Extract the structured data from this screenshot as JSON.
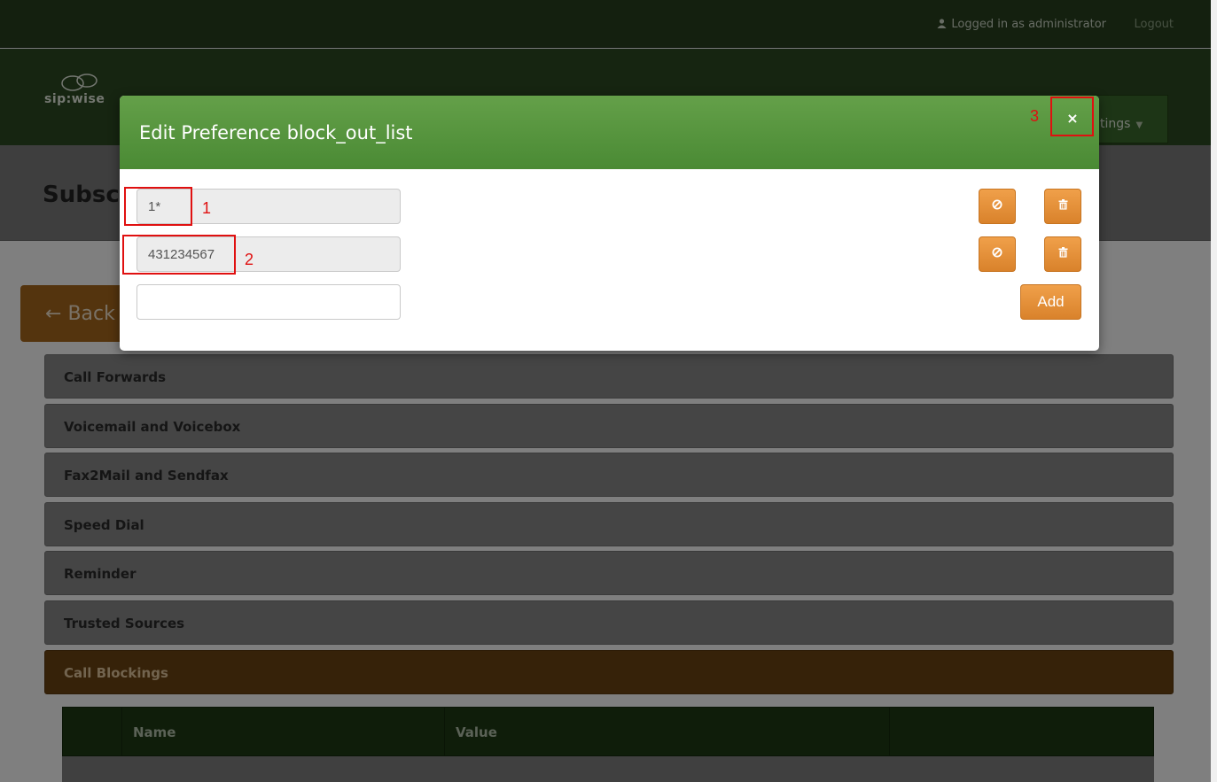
{
  "topbar": {
    "login_text": "Logged in as administrator",
    "logout_label": "Logout"
  },
  "nav": {
    "logo_text": "sip:wise",
    "settings_label": "tings"
  },
  "page": {
    "title": "Subsc",
    "back_label": "Back"
  },
  "accordion": [
    {
      "label": "Call Forwards"
    },
    {
      "label": "Voicemail and Voicebox"
    },
    {
      "label": "Fax2Mail and Sendfax"
    },
    {
      "label": "Speed Dial"
    },
    {
      "label": "Reminder"
    },
    {
      "label": "Trusted Sources"
    },
    {
      "label": "Call Blockings",
      "active": true
    }
  ],
  "table": {
    "columns": [
      "",
      "Name",
      "Value",
      ""
    ]
  },
  "modal": {
    "title": "Edit Preference block_out_list",
    "close_symbol": "×",
    "entries": [
      {
        "value": "1*"
      },
      {
        "value": "431234567"
      }
    ],
    "new_entry_value": "",
    "add_label": "Add",
    "disable_icon": "ban-icon",
    "delete_icon": "trash-icon"
  },
  "annotations": [
    {
      "number": "1"
    },
    {
      "number": "2"
    },
    {
      "number": "3"
    }
  ],
  "colors": {
    "header_green": "#4a8a34",
    "action_orange": "#e38d33",
    "annotation_red": "#e01010"
  }
}
